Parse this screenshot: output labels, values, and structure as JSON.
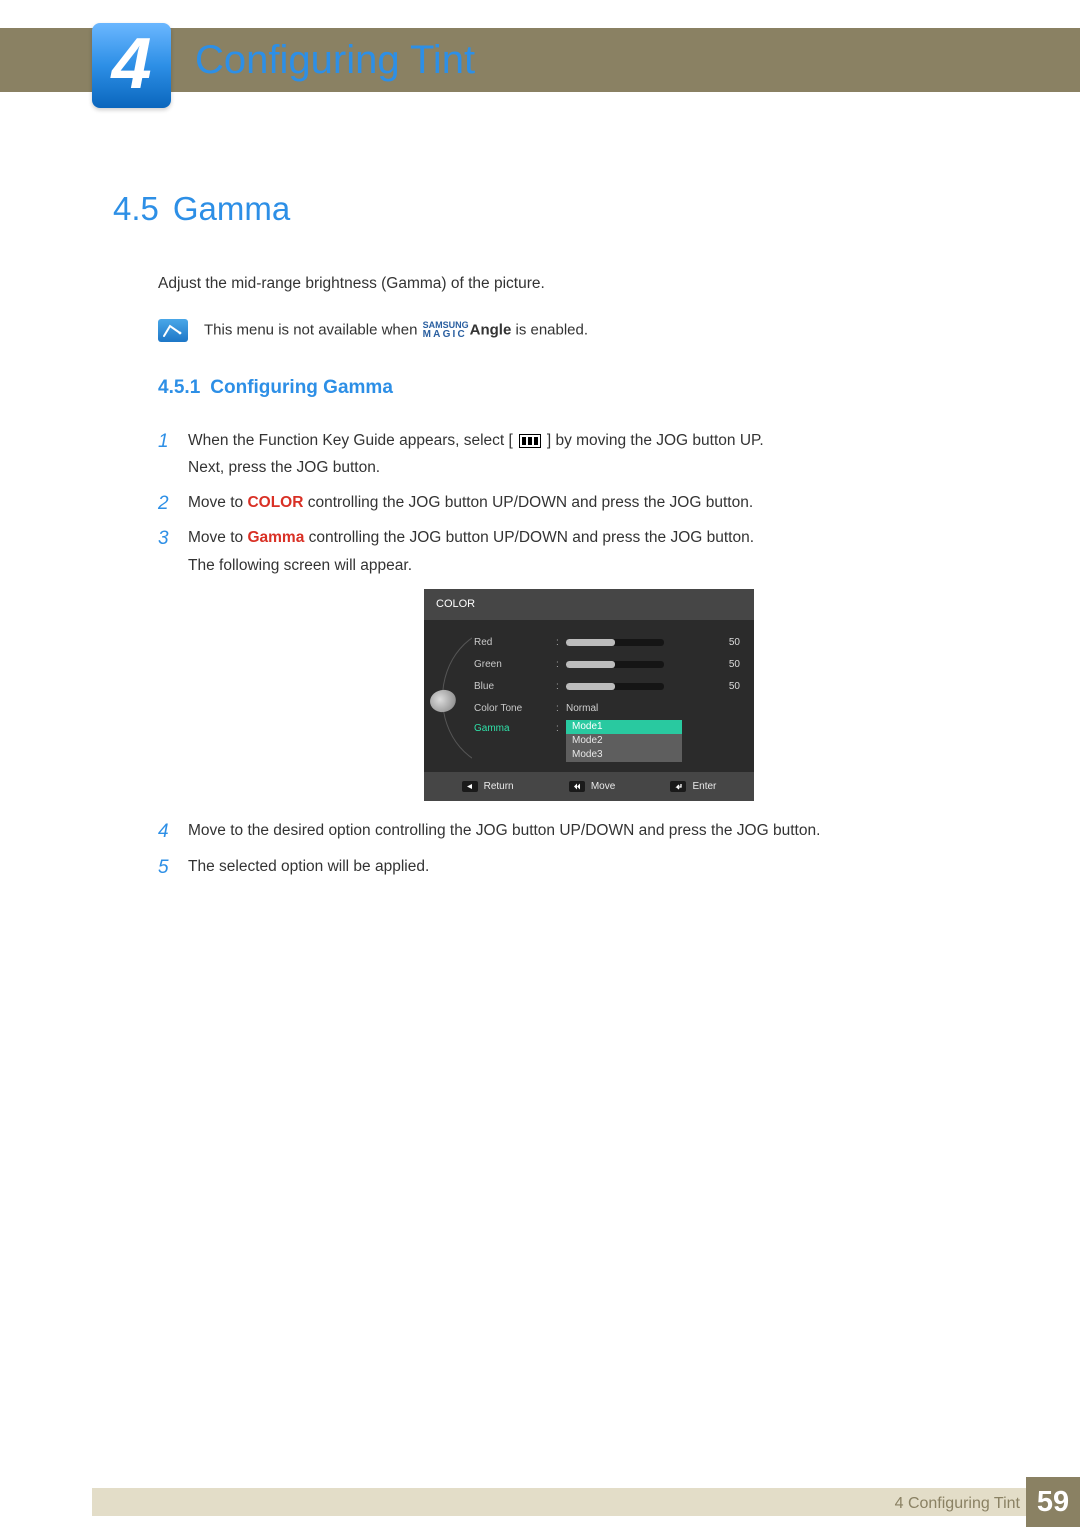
{
  "chapter": {
    "number": "4",
    "title": "Configuring Tint"
  },
  "section": {
    "number": "4.5",
    "title": "Gamma"
  },
  "intro": "Adjust the mid-range brightness (Gamma) of the picture.",
  "note": {
    "before": "This menu is not available when ",
    "brand_top": "SAMSUNG",
    "brand_bottom": "MAGIC",
    "feature": "Angle",
    "after": " is enabled."
  },
  "subsection": {
    "number": "4.5.1",
    "title": "Configuring Gamma"
  },
  "steps": {
    "s1a": "When the Function Key Guide appears, select ",
    "s1b": " by moving the JOG button UP.",
    "s1c": "Next, press the JOG button.",
    "s2a": "Move to ",
    "s2color": "COLOR",
    "s2b": " controlling the JOG button UP/DOWN and press the JOG button.",
    "s3a": "Move to ",
    "s3gamma": "Gamma",
    "s3b": " controlling the JOG button UP/DOWN and press the JOG button.",
    "s3c": "The following screen will appear.",
    "s4": "Move to the desired option controlling the JOG button UP/DOWN and press the JOG button.",
    "s5": "The selected option will be applied."
  },
  "osd": {
    "title": "COLOR",
    "rows": {
      "red": {
        "label": "Red",
        "value": "50",
        "pct": 50
      },
      "green": {
        "label": "Green",
        "value": "50",
        "pct": 50
      },
      "blue": {
        "label": "Blue",
        "value": "50",
        "pct": 50
      },
      "tone": {
        "label": "Color Tone",
        "value": "Normal"
      },
      "gamma": {
        "label": "Gamma",
        "options": [
          "Mode1",
          "Mode2",
          "Mode3"
        ],
        "selected": 0
      }
    },
    "footer": {
      "return": "Return",
      "move": "Move",
      "enter": "Enter"
    }
  },
  "footer": {
    "chapter_label": "4 Configuring Tint",
    "page": "59"
  }
}
